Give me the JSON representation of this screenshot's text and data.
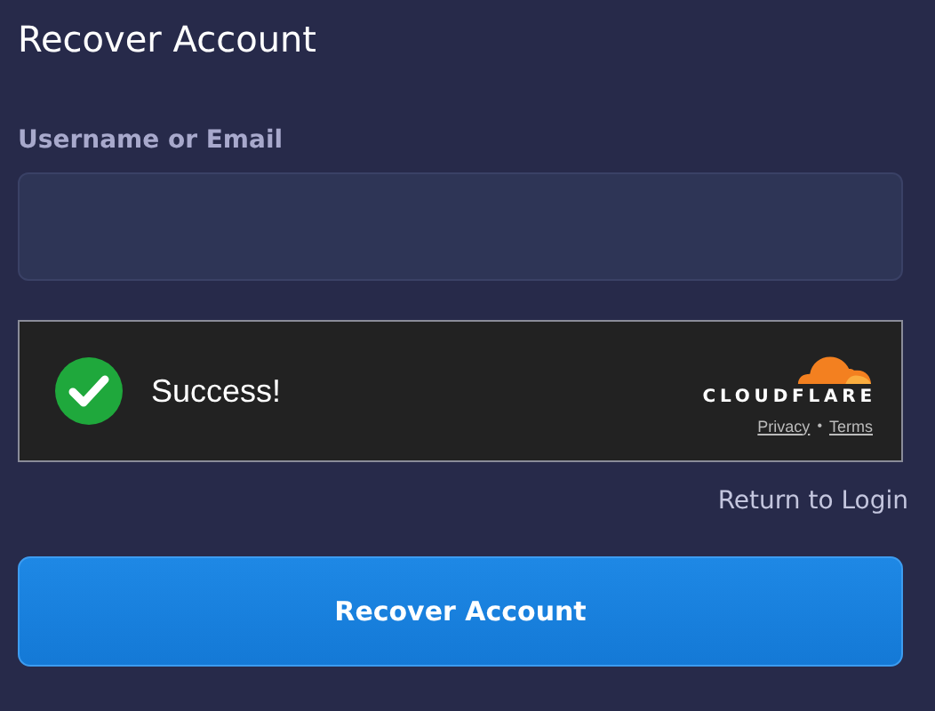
{
  "title": "Recover Account",
  "field": {
    "label": "Username or Email"
  },
  "captcha": {
    "status": {
      "kind": "success",
      "text": "Success!"
    },
    "brand": "CLOUDFLARE",
    "links": [
      "Privacy",
      "Terms"
    ],
    "separator": "•"
  },
  "return_link": "Return to Login",
  "submit_button": "Recover Account"
}
